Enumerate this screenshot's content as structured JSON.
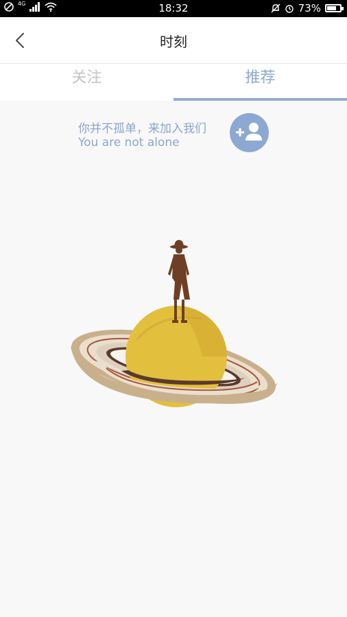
{
  "status_bar": {
    "network": "4G",
    "time": "18:32",
    "battery_percent_label": "73%",
    "battery_level": 0.73
  },
  "header": {
    "title": "时刻"
  },
  "tabs": [
    {
      "label": "关注",
      "selected": false
    },
    {
      "label": "推荐",
      "selected": true
    }
  ],
  "promo": {
    "text_cn": "你并不孤单，来加入我们",
    "text_en": "You are not alone"
  },
  "colors": {
    "accent": "#93a9d1",
    "promo_text": "#8aa5cf",
    "tab_inactive": "#c3c3c6",
    "background": "#f8f8f9",
    "planet": "#e3bf3e",
    "silhouette": "#6e3f25"
  },
  "icons": {
    "back": "chevron-left-icon",
    "add_friend": "add-user-icon"
  }
}
